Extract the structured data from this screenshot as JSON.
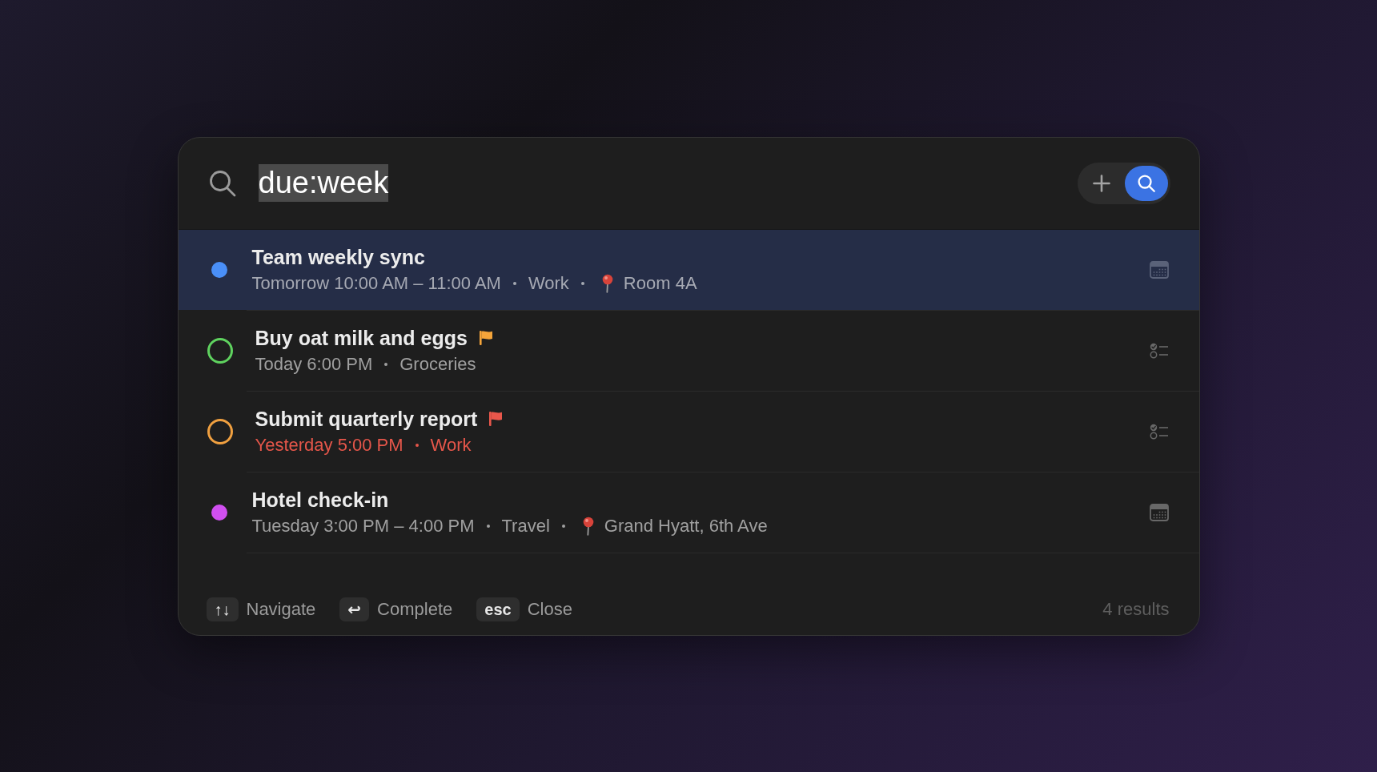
{
  "search": {
    "query": "due:week",
    "query_selected": true
  },
  "actions": [
    {
      "kind": "add",
      "active": false
    },
    {
      "kind": "search",
      "active": true
    }
  ],
  "results": [
    {
      "kind": "event",
      "title": "Team weekly sync",
      "selected": true,
      "color": "#4a8ff8",
      "overdue": false,
      "time": "Tomorrow 10:00 AM – 11:00 AM",
      "list": "Work",
      "location": "Room 4A"
    },
    {
      "kind": "task",
      "title": "Buy oat milk and eggs",
      "selected": false,
      "color": "#5fd35f",
      "overdue": false,
      "flag": {
        "color": "#f5a53a"
      },
      "time": "Today 6:00 PM",
      "list": "Groceries"
    },
    {
      "kind": "task",
      "title": "Submit quarterly report",
      "selected": false,
      "color": "#f0a040",
      "overdue": true,
      "flag": {
        "color": "#e9574b"
      },
      "time": "Yesterday 5:00 PM",
      "list": "Work"
    },
    {
      "kind": "event",
      "title": "Hotel check-in",
      "selected": false,
      "color": "#d04ff0",
      "overdue": false,
      "time": "Tuesday 3:00 PM – 4:00 PM",
      "list": "Travel",
      "location": "Grand Hyatt, 6th Ave"
    }
  ],
  "shortcuts": [
    {
      "keys": "↑↓",
      "label": "Navigate"
    },
    {
      "keys": "↩",
      "label": "Complete"
    },
    {
      "keys": "esc",
      "label": "Close"
    }
  ],
  "result_count": "4 results"
}
